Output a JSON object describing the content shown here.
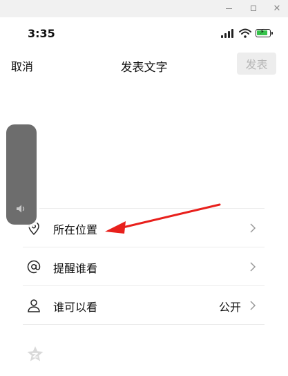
{
  "window": {
    "minimize_label": "minimize",
    "maximize_label": "maximize",
    "close_glyph": "✕"
  },
  "status_bar": {
    "time": "3:35",
    "battery_color": "#35c24a"
  },
  "nav": {
    "cancel": "取消",
    "title": "发表文字",
    "publish": "发表"
  },
  "options": [
    {
      "icon": "location-pin-icon",
      "label": "所在位置",
      "value": ""
    },
    {
      "icon": "at-icon",
      "label": "提醒谁看",
      "value": ""
    },
    {
      "icon": "person-icon",
      "label": "谁可以看",
      "value": "公开"
    }
  ],
  "overlay": {
    "volume_icon": "speaker-icon",
    "annotation_color": "#e8201c"
  },
  "emoji_icon": "emoji-star-icon"
}
